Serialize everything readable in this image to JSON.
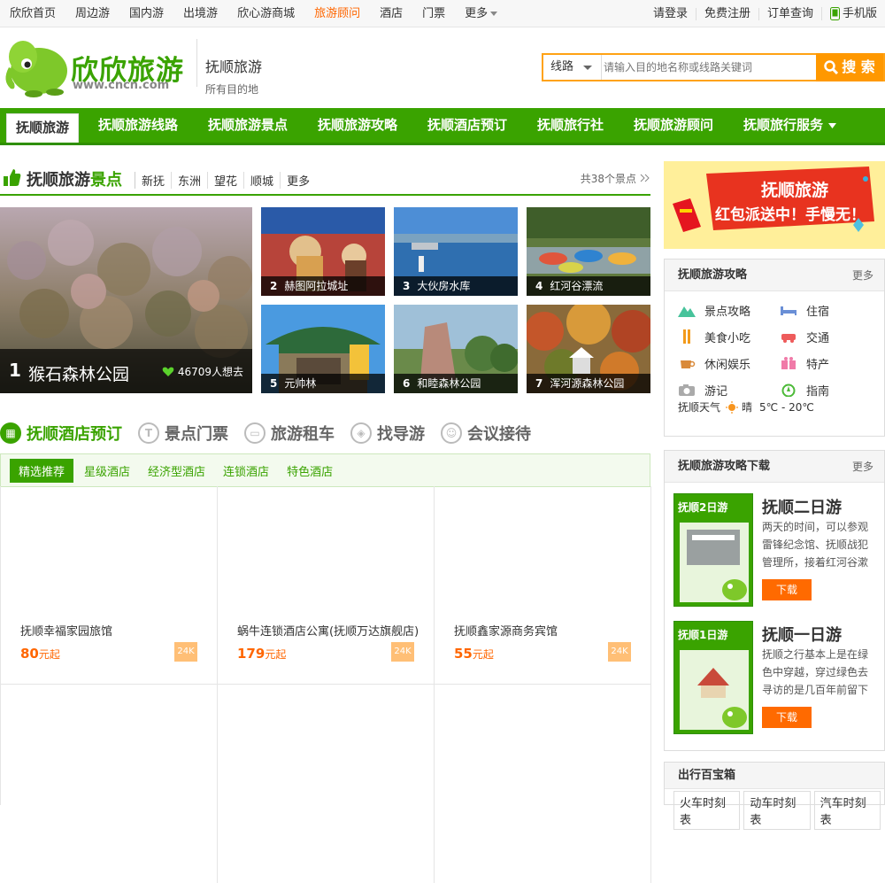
{
  "topnav": {
    "items": [
      "欣欣首页",
      "周边游",
      "国内游",
      "出境游",
      "欣心游商城",
      "旅游顾问",
      "酒店",
      "门票",
      "更多"
    ],
    "right": [
      "请登录",
      "免费注册",
      "订单查询",
      "手机版"
    ]
  },
  "logo": {
    "name": "欣欣旅游",
    "url_text": "www.cncn.com"
  },
  "brand": {
    "title": "抚顺旅游",
    "slogan": "所有目的地"
  },
  "search": {
    "select": "线路",
    "placeholder": "请输入目的地名称或线路关键词",
    "button": "搜 索"
  },
  "mainnav": [
    "抚顺旅游",
    "抚顺旅游线路",
    "抚顺旅游景点",
    "抚顺旅游攻略",
    "抚顺酒店预订",
    "抚顺旅行社",
    "抚顺旅游顾问",
    "抚顺旅行服务"
  ],
  "scenic": {
    "title_a": "抚顺旅游",
    "title_b": "景点",
    "links": [
      "新抚",
      "东洲",
      "望花",
      "顺城",
      "更多"
    ],
    "count": "共38个景点",
    "big": {
      "num": "1",
      "name": "猴石森林公园",
      "likes": "46709人想去"
    },
    "thumbs": [
      {
        "num": "2",
        "name": "赫图阿拉城址"
      },
      {
        "num": "3",
        "name": "大伙房水库"
      },
      {
        "num": "4",
        "name": "红河谷漂流"
      },
      {
        "num": "5",
        "name": "元帅林"
      },
      {
        "num": "6",
        "name": "和睦森林公园"
      },
      {
        "num": "7",
        "name": "浑河源森林公园"
      }
    ]
  },
  "services": [
    "抚顺酒店预订",
    "景点门票",
    "旅游租车",
    "找导游",
    "会议接待"
  ],
  "hotel_tabs": [
    "精选推荐",
    "星级酒店",
    "经济型酒店",
    "连锁酒店",
    "特色酒店"
  ],
  "hotels": [
    {
      "name": "抚顺幸福家园旅馆",
      "price": "80",
      "unit": "元起",
      "tag": "24K"
    },
    {
      "name": "蜗牛连锁酒店公寓(抚顺万达旗舰店)",
      "price": "179",
      "unit": "元起",
      "tag": "24K"
    },
    {
      "name": "抚顺鑫家源商务宾馆",
      "price": "55",
      "unit": "元起",
      "tag": "24K"
    }
  ],
  "ad": {
    "line1": "抚顺旅游",
    "line2": "红包派送中！手慢无！"
  },
  "guide_panel": {
    "title": "抚顺旅游攻略",
    "more": "更多",
    "items": [
      "景点攻略",
      "住宿",
      "美食小吃",
      "交通",
      "休闲娱乐",
      "特产",
      "游记",
      "指南"
    ],
    "weather_label": "抚顺天气",
    "weather": "晴",
    "temp": "5℃ - 20℃"
  },
  "download_panel": {
    "title": "抚顺旅游攻略下载",
    "more": "更多",
    "items": [
      {
        "cover": "抚顺2日游",
        "title": "抚顺二日游",
        "desc": "两天的时间，可以参观雷锋纪念馆、抚顺战犯管理所，接着红河谷漱",
        "btn": "下载"
      },
      {
        "cover": "抚顺1日游",
        "title": "抚顺一日游",
        "desc": "抚顺之行基本上是在绿色中穿越，穿过绿色去寻访的是几百年前留下",
        "btn": "下载"
      }
    ]
  },
  "travel_box": {
    "title": "出行百宝箱",
    "tabs": [
      "火车时刻表",
      "动车时刻表",
      "汽车时刻表"
    ]
  },
  "colors": {
    "green": "#3aa300",
    "orange": "#ff9800",
    "highlight": "#ff6600"
  }
}
